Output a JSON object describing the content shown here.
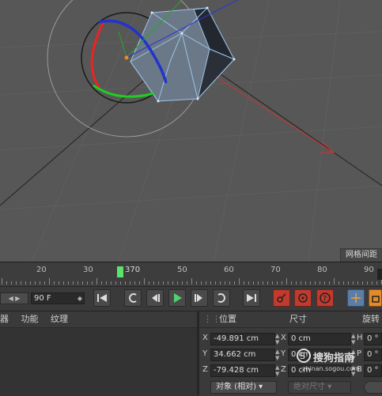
{
  "viewport": {
    "grid_label": "网格间距"
  },
  "timeline": {
    "ticks": [
      "20",
      "30",
      "50",
      "60",
      "70",
      "80",
      "90"
    ],
    "playhead_label": "370"
  },
  "transport": {
    "frame_value": "90 F",
    "nav_arrows": "◀ ▶"
  },
  "bottom_left": {
    "menu": [
      "功能",
      "纹理"
    ],
    "menu_partial": "器"
  },
  "coordinates": {
    "headers": [
      "位置",
      "尺寸",
      "旋转"
    ],
    "rows": [
      {
        "axis": "X",
        "position": "-49.891 cm",
        "size_axis": "X",
        "size": "0 cm",
        "rot_axis": "H",
        "rotation": "0 °"
      },
      {
        "axis": "Y",
        "position": "34.662 cm",
        "size_axis": "Y",
        "size": "0 cm",
        "rot_axis": "P",
        "rotation": "0 °"
      },
      {
        "axis": "Z",
        "position": "-79.428 cm",
        "size_axis": "Z",
        "size": "0 cm",
        "rot_axis": "B",
        "rotation": "0 °"
      }
    ],
    "mode_dropdown": "对象 (相对)",
    "size_dropdown": "绝对尺寸"
  },
  "watermark": {
    "text": "搜狗指南",
    "url": "zhinan.sogou.com"
  },
  "colors": {
    "viewport_bg": "#575757",
    "panel_bg": "#3a3a3a",
    "accent_green": "#5be36b",
    "accent_red": "#c03a2e",
    "accent_orange": "#e08b2c"
  }
}
